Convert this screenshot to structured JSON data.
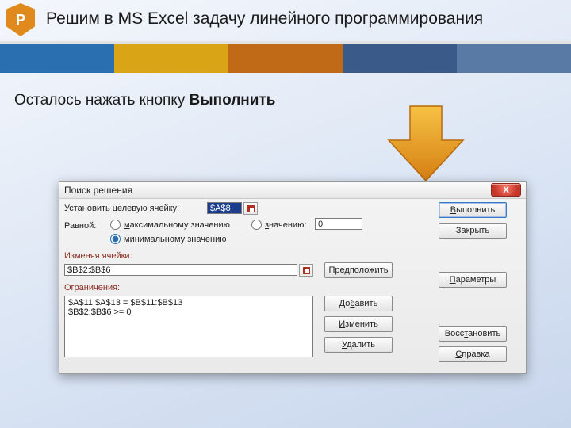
{
  "slide": {
    "logo_letter": "P",
    "title": "Решим в MS Excel задачу линейного программирования",
    "instruction_prefix": "Осталось нажать кнопку ",
    "instruction_bold": "Выполнить"
  },
  "dialog": {
    "title": "Поиск решения",
    "target_label": "Установить целевую ячейку:",
    "target_value": "$A$8",
    "equal_label": "Равной:",
    "opt_max": "максимальному значению",
    "opt_min": "минимальному значению",
    "opt_value": "значению:",
    "value_input": "0",
    "changing_section": "Изменяя ячейки:",
    "changing_value": "$B$2:$B$6",
    "constraints_section": "Ограничения:",
    "constraints": [
      "$A$11:$A$13 = $B$11:$B$13",
      "$B$2:$B$6 >= 0"
    ],
    "btn_execute": "Выполнить",
    "btn_close": "Закрыть",
    "btn_guess": "Предположить",
    "btn_add": "Добавить",
    "btn_change": "Изменить",
    "btn_delete": "Удалить",
    "btn_params": "Параметры",
    "btn_restore": "Восстановить",
    "btn_help": "Справка",
    "close_x": "X"
  }
}
